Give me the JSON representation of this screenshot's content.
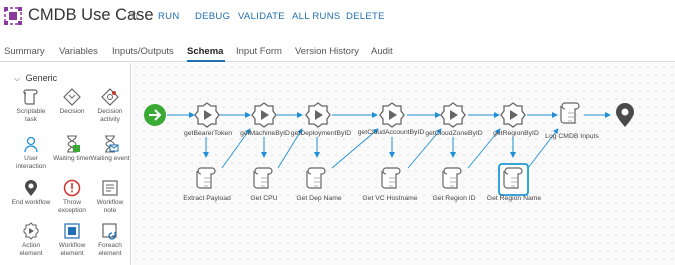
{
  "header": {
    "title": "CMDB Use Case",
    "actions": [
      "RUN",
      "DEBUG",
      "VALIDATE",
      "ALL RUNS",
      "DELETE"
    ]
  },
  "tabs": [
    "Summary",
    "Variables",
    "Inputs/Outputs",
    "Schema",
    "Input Form",
    "Version History",
    "Audit"
  ],
  "active_tab": "Schema",
  "palette": {
    "group": "Generic",
    "items": [
      {
        "label": "Scriptable task",
        "icon": "scroll-icon"
      },
      {
        "label": "Decision",
        "icon": "decision-icon"
      },
      {
        "label": "Decision activity",
        "icon": "decision-activity-icon"
      },
      {
        "label": "User interaction",
        "icon": "user-icon"
      },
      {
        "label": "Waiting timer",
        "icon": "hourglass-icon"
      },
      {
        "label": "Waiting event",
        "icon": "hourglass-event-icon"
      },
      {
        "label": "End workflow",
        "icon": "location-pin-icon"
      },
      {
        "label": "Throw exception",
        "icon": "exception-icon"
      },
      {
        "label": "Workflow note",
        "icon": "note-icon"
      },
      {
        "label": "Action element",
        "icon": "action-gear-icon"
      },
      {
        "label": "Workflow element",
        "icon": "workflow-element-icon"
      },
      {
        "label": "Foreach element",
        "icon": "foreach-icon"
      }
    ]
  },
  "schema": {
    "top_nodes": [
      "getBearerToken",
      "getMachineByID",
      "getDeploymentByID",
      "getCloudAccountByID",
      "getCloudZoneByID",
      "getRegionByID",
      "Log CMDB Inputs"
    ],
    "bottom_nodes": [
      "Extract Payload",
      "Get CPU",
      "Get Dep Name",
      "Get VC Hostname",
      "Get Region ID",
      "Get Region Name"
    ],
    "selected_node": "Get Region Name"
  },
  "colors": {
    "accent": "#1f6fb2",
    "start": "#3aaa35",
    "end": "#4a4a4a",
    "selected_border": "#1f9ad6",
    "logo": "#8a3a9e"
  }
}
